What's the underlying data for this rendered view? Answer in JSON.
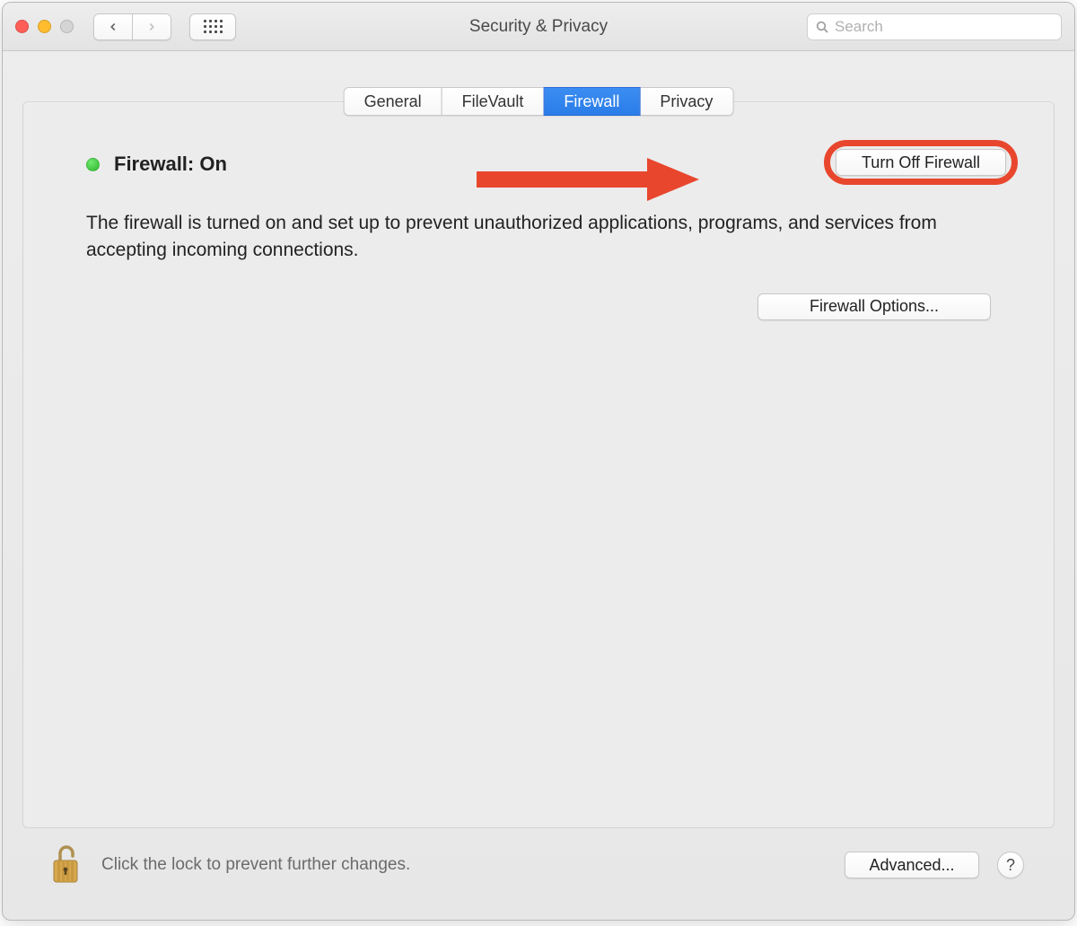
{
  "window": {
    "title": "Security & Privacy",
    "search_placeholder": "Search"
  },
  "tabs": [
    {
      "label": "General"
    },
    {
      "label": "FileVault"
    },
    {
      "label": "Firewall",
      "active": true
    },
    {
      "label": "Privacy"
    }
  ],
  "firewall": {
    "status_label": "Firewall: On",
    "status_color": "#2fb92f",
    "turn_off_label": "Turn Off Firewall",
    "description": "The firewall is turned on and set up to prevent unauthorized applications, programs, and services from accepting incoming connections.",
    "options_label": "Firewall Options..."
  },
  "footer": {
    "lock_hint": "Click the lock to prevent further changes.",
    "advanced_label": "Advanced...",
    "help_label": "?"
  },
  "annotation": {
    "highlight_color": "#e8472e"
  }
}
